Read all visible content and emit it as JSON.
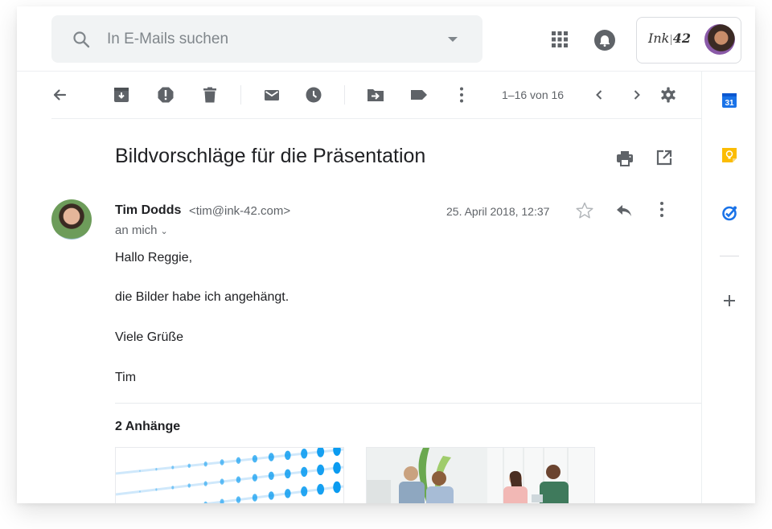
{
  "search": {
    "placeholder": "In E-Mails suchen",
    "icon": "search-icon",
    "options_icon": "caret-down-icon"
  },
  "header": {
    "apps_icon": "apps-grid-icon",
    "notifications_icon": "bell-icon",
    "account": {
      "logo_text_left": "Ink",
      "logo_separator": "|",
      "logo_text_right": "42",
      "avatar_icon": "account-avatar"
    }
  },
  "toolbar": {
    "buttons": [
      {
        "name": "back",
        "icon": "arrow-left-icon"
      },
      {
        "name": "archive",
        "icon": "archive-icon"
      },
      {
        "name": "report-spam",
        "icon": "report-icon"
      },
      {
        "name": "delete",
        "icon": "trash-icon"
      },
      {
        "name": "mark-unread",
        "icon": "mail-icon"
      },
      {
        "name": "snooze",
        "icon": "clock-icon"
      },
      {
        "name": "move-to",
        "icon": "folder-move-icon"
      },
      {
        "name": "label",
        "icon": "label-icon"
      },
      {
        "name": "more",
        "icon": "more-vert-icon"
      }
    ],
    "pager": {
      "text": "1–16 von 16",
      "prev_icon": "chevron-left-icon",
      "next_icon": "chevron-right-icon"
    },
    "settings_icon": "gear-icon"
  },
  "sidepanel": {
    "items": [
      {
        "name": "calendar",
        "label": "31",
        "color": "#1a73e8"
      },
      {
        "name": "keep",
        "color": "#fbbc04"
      },
      {
        "name": "tasks",
        "color": "#1a73e8"
      }
    ],
    "add_icon": "plus-icon"
  },
  "email": {
    "subject": "Bildvorschläge für die Präsentation",
    "print_icon": "print-icon",
    "open_new_window_icon": "open-in-new-icon",
    "sender": {
      "name": "Tim Dodds",
      "email": "<tim@ink-42.com>",
      "recipient": "an mich",
      "recipient_chevron": "⌄"
    },
    "date": "25. April 2018, 12:37",
    "star_icon": "star-outline-icon",
    "reply_icon": "reply-icon",
    "more_icon": "more-vert-icon",
    "body": [
      "Hallo Reggie,",
      "die Bilder habe ich angehängt.",
      "Viele Grüße",
      "Tim"
    ],
    "attachments": {
      "title": "2 Anhänge",
      "items": [
        {
          "name": "blue-dots-image"
        },
        {
          "name": "office-meeting-image"
        }
      ]
    }
  },
  "colors": {
    "icon_gray": "#5f6368",
    "search_bg": "#f1f3f4",
    "accent_blue": "#1a73e8",
    "keep_yellow": "#fbbc04"
  }
}
